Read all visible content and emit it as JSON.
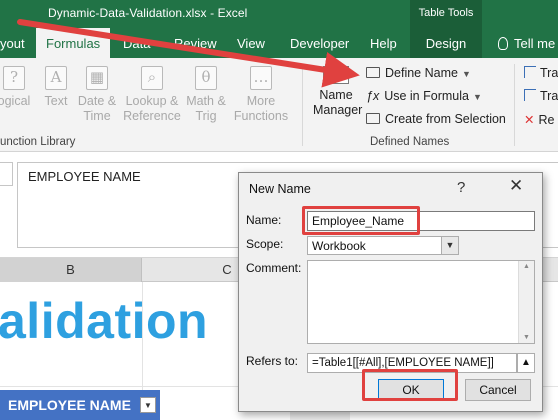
{
  "title_bar": {
    "title": "Dynamic-Data-Validation.xlsx  -  Excel",
    "table_tools": "Table Tools"
  },
  "tabs": [
    {
      "label": "yout"
    },
    {
      "label": "Formulas"
    },
    {
      "label": "Data"
    },
    {
      "label": "Review"
    },
    {
      "label": "View"
    },
    {
      "label": "Developer"
    },
    {
      "label": "Help"
    },
    {
      "label": "Design"
    },
    {
      "label": "Tell me"
    }
  ],
  "ribbon": {
    "function_buttons": [
      {
        "line1": "ogical",
        "line2": "",
        "icon": "?"
      },
      {
        "line1": "Text",
        "line2": "",
        "icon": "A"
      },
      {
        "line1": "Date &",
        "line2": "Time",
        "icon": "▦"
      },
      {
        "line1": "Lookup &",
        "line2": "Reference",
        "icon": "⌕"
      },
      {
        "line1": "Math &",
        "line2": "Trig",
        "icon": "θ"
      },
      {
        "line1": "More",
        "line2": "Functions",
        "icon": "…"
      }
    ],
    "function_library_label": "unction Library",
    "name_manager_line1": "Name",
    "name_manager_line2": "Manager",
    "define_name": "Define Name",
    "use_in_formula": "Use in Formula",
    "create_from_selection": "Create from Selection",
    "defined_names_label": "Defined Names",
    "trace_items": [
      "Tra",
      "Tra",
      "Re"
    ]
  },
  "formula_bar": {
    "content": "EMPLOYEE NAME"
  },
  "sheet": {
    "col_b": "B",
    "col_c": "C",
    "big_title": "alidation",
    "table_header": "EMPLOYEE NAME"
  },
  "dialog": {
    "title": "New Name",
    "help": "?",
    "close": "✕",
    "name_label": "Name:",
    "name_value": "Employee_Name",
    "scope_label": "Scope:",
    "scope_value": "Workbook",
    "comment_label": "Comment:",
    "refers_label": "Refers to:",
    "refers_value": "=Table1[[#All],[EMPLOYEE NAME]]",
    "ok": "OK",
    "cancel": "Cancel"
  },
  "colors": {
    "excel_green": "#217346",
    "highlight_red": "#e0413f",
    "table_blue": "#4472c4",
    "title_blue": "#2ea0e0"
  }
}
